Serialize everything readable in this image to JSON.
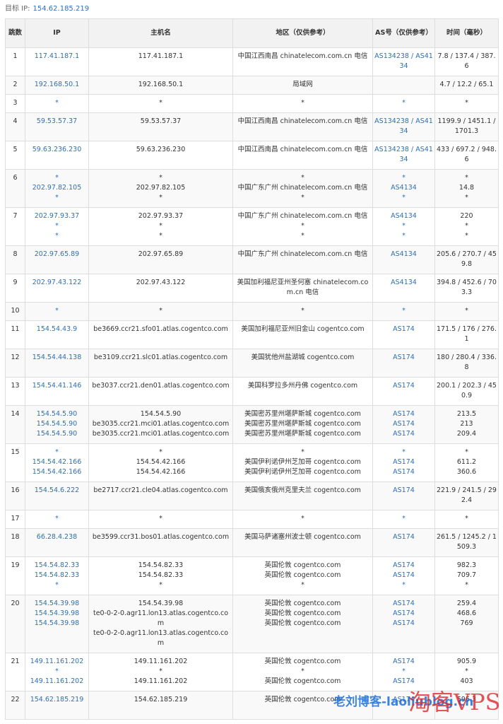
{
  "target": {
    "label": "目标 IP:",
    "ip": "154.62.185.219"
  },
  "headers": {
    "hop": "跳数",
    "ip": "IP",
    "host": "主机名",
    "region": "地区（仅供参考）",
    "as": "AS号（仅供参考）",
    "time": "时间（毫秒）"
  },
  "rows": [
    {
      "hop": "1",
      "ip": "117.41.187.1",
      "host": "117.41.187.1",
      "region": "中国江西南昌 chinatelecom.com.cn 电信",
      "as": "AS134238 / AS4134",
      "time": "7.8 / 137.4 / 387.6"
    },
    {
      "hop": "2",
      "ip": "192.168.50.1",
      "host": "192.168.50.1",
      "region": "局域网",
      "as": "",
      "time": "4.7 / 12.2 / 65.1"
    },
    {
      "hop": "3",
      "ip": "*",
      "host": "*",
      "region": "*",
      "as": "*",
      "time": "*"
    },
    {
      "hop": "4",
      "ip": "59.53.57.37",
      "host": "59.53.57.37",
      "region": "中国江西南昌 chinatelecom.com.cn 电信",
      "as": "AS134238 / AS4134",
      "time": "1199.9 / 1451.1 / 1701.3"
    },
    {
      "hop": "5",
      "ip": "59.63.236.230",
      "host": "59.63.236.230",
      "region": "中国江西南昌 chinatelecom.com.cn 电信",
      "as": "AS134238 / AS4134",
      "time": "433 / 697.2 / 948.6"
    },
    {
      "hop": "6",
      "ip": "*\n202.97.82.105\n*",
      "host": "*\n202.97.82.105\n*",
      "region": "*\n中国广东广州 chinatelecom.com.cn 电信\n*",
      "as": "*\nAS4134\n*",
      "time": "*\n14.8\n*"
    },
    {
      "hop": "7",
      "ip": "202.97.93.37\n*\n*",
      "host": "202.97.93.37\n*\n*",
      "region": "中国广东广州 chinatelecom.com.cn 电信\n*\n*",
      "as": "AS4134\n*\n*",
      "time": "220\n*\n*"
    },
    {
      "hop": "8",
      "ip": "202.97.65.89",
      "host": "202.97.65.89",
      "region": "中国广东广州 chinatelecom.com.cn 电信",
      "as": "AS4134",
      "time": "205.6 / 270.7 / 459.8"
    },
    {
      "hop": "9",
      "ip": "202.97.43.122",
      "host": "202.97.43.122",
      "region": "美国加利福尼亚州圣何塞 chinatelecom.com.cn 电信",
      "as": "AS4134",
      "time": "394.8 / 452.6 / 703.3"
    },
    {
      "hop": "10",
      "ip": "*",
      "host": "*",
      "region": "*",
      "as": "*",
      "time": "*"
    },
    {
      "hop": "11",
      "ip": "154.54.43.9",
      "host": "be3669.ccr21.sfo01.atlas.cogentco.com",
      "region": "美国加利福尼亚州旧金山 cogentco.com",
      "as": "AS174",
      "time": "171.5 / 176 / 276.1"
    },
    {
      "hop": "12",
      "ip": "154.54.44.138",
      "host": "be3109.ccr21.slc01.atlas.cogentco.com",
      "region": "美国犹他州盐湖城 cogentco.com",
      "as": "AS174",
      "time": "180 / 280.4 / 336.8"
    },
    {
      "hop": "13",
      "ip": "154.54.41.146",
      "host": "be3037.ccr21.den01.atlas.cogentco.com",
      "region": "美国科罗拉多州丹佛 cogentco.com",
      "as": "AS174",
      "time": "200.1 / 202.3 / 450.9"
    },
    {
      "hop": "14",
      "ip": "154.54.5.90\n154.54.5.90\n154.54.5.90",
      "host": "154.54.5.90\nbe3035.ccr21.mci01.atlas.cogentco.com\nbe3035.ccr21.mci01.atlas.cogentco.com",
      "region": "美国密苏里州堪萨斯城 cogentco.com\n美国密苏里州堪萨斯城 cogentco.com\n美国密苏里州堪萨斯城 cogentco.com",
      "as": "AS174\nAS174\nAS174",
      "time": "213.5\n213\n209.4"
    },
    {
      "hop": "15",
      "ip": "*\n154.54.42.166\n154.54.42.166",
      "host": "*\n154.54.42.166\n154.54.42.166",
      "region": "*\n美国伊利诺伊州芝加哥 cogentco.com\n美国伊利诺伊州芝加哥 cogentco.com",
      "as": "*\nAS174\nAS174",
      "time": "*\n611.2\n360.6"
    },
    {
      "hop": "16",
      "ip": "154.54.6.222",
      "host": "be2717.ccr21.cle04.atlas.cogentco.com",
      "region": "美国俄亥俄州克里夫兰 cogentco.com",
      "as": "AS174",
      "time": "221.9 / 241.5 / 292.4"
    },
    {
      "hop": "17",
      "ip": "*",
      "host": "*",
      "region": "*",
      "as": "*",
      "time": "*"
    },
    {
      "hop": "18",
      "ip": "66.28.4.238",
      "host": "be3599.ccr31.bos01.atlas.cogentco.com",
      "region": "美国马萨诸塞州波士顿 cogentco.com",
      "as": "AS174",
      "time": "261.5 / 1245.2 / 1509.3"
    },
    {
      "hop": "19",
      "ip": "154.54.82.33\n154.54.82.33\n*",
      "host": "154.54.82.33\n154.54.82.33\n*",
      "region": "英国伦敦 cogentco.com\n英国伦敦 cogentco.com\n*",
      "as": "AS174\nAS174\n*",
      "time": "982.3\n709.7\n*"
    },
    {
      "hop": "20",
      "ip": "154.54.39.98\n154.54.39.98\n154.54.39.98",
      "host": "154.54.39.98\nte0-0-2-0.agr11.lon13.atlas.cogentco.com\nte0-0-2-0.agr11.lon13.atlas.cogentco.com",
      "region": "英国伦敦 cogentco.com\n英国伦敦 cogentco.com\n英国伦敦 cogentco.com",
      "as": "AS174\nAS174\nAS174",
      "time": "259.4\n468.6\n769"
    },
    {
      "hop": "21",
      "ip": "149.11.161.202\n*\n149.11.161.202",
      "host": "149.11.161.202\n*\n149.11.161.202",
      "region": "英国伦敦 cogentco.com\n*\n英国伦敦 cogentco.com",
      "as": "AS174\n*\nAS174",
      "time": "905.9\n*\n403"
    },
    {
      "hop": "22",
      "ip": "154.62.185.219",
      "host": "154.62.185.219",
      "region": "英国伦敦 cogentco.com",
      "as": "AS174",
      "time": "595.3"
    }
  ],
  "watermark": {
    "blog": "老刘博客-laoliublog.cn",
    "brand": "淘客VPS"
  }
}
